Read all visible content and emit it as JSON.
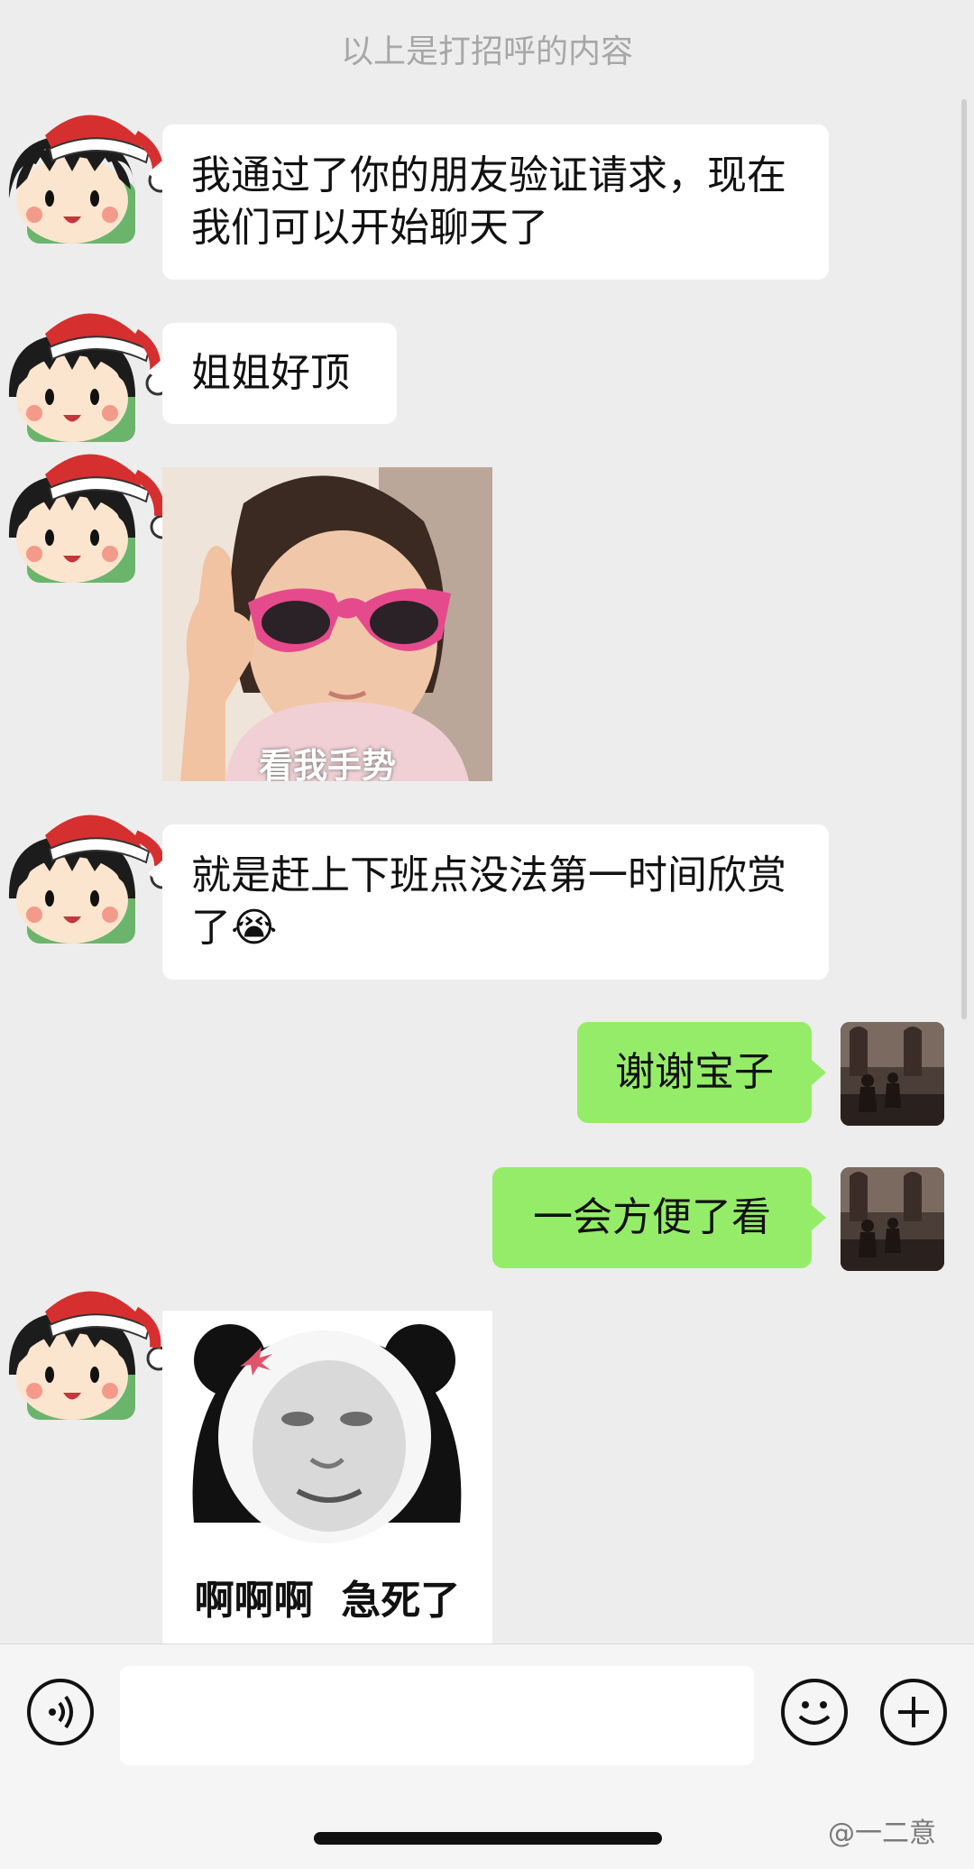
{
  "system_note": "以上是打招呼的内容",
  "messages": {
    "m1": "我通过了你的朋友验证请求，现在我们可以开始聊天了",
    "m2": "姐姐好顶",
    "m3_sticker_caption": "看我手势",
    "m4": "就是赶上下班点没法第一时间欣赏了",
    "m4_emoji": "😭",
    "m5": "谢谢宝子",
    "m6": "一会方便了看",
    "m7_sticker_caption": "啊啊啊  急死了"
  },
  "composer": {
    "voice_icon": "voice-icon",
    "emoji_icon": "emoji-icon",
    "plus_icon": "plus-icon"
  },
  "watermark": "@一二意",
  "colors": {
    "incoming_bubble": "#ffffff",
    "outgoing_bubble": "#95ec69",
    "background": "#ededed"
  }
}
